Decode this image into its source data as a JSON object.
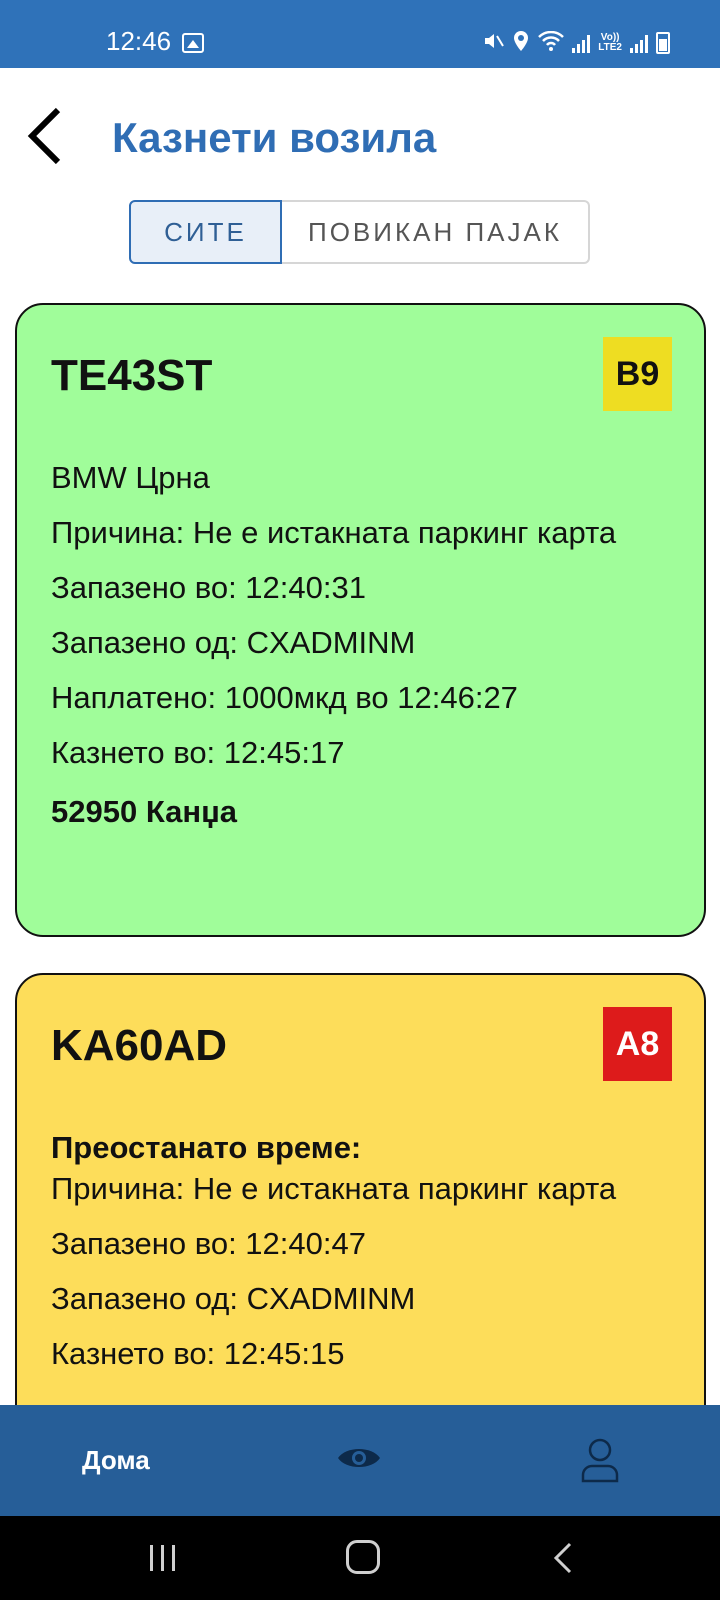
{
  "status_bar": {
    "time": "12:46",
    "icons": [
      "gallery-icon",
      "mute-icon",
      "location-icon",
      "wifi-icon",
      "signal-icon",
      "volte-icon",
      "signal-icon",
      "battery-icon"
    ],
    "volte_label_top": "Vo))",
    "volte_label_bottom": "LTE2"
  },
  "header": {
    "title": "Казнети возила",
    "back_icon": "back-arrow-icon"
  },
  "tabs": [
    {
      "label": "СИТЕ",
      "active": true
    },
    {
      "label": "ПОВИКАН ПАЈАК",
      "active": false
    }
  ],
  "cards": [
    {
      "plate": "TE43ST",
      "badge": "B9",
      "color": "#a0fd9a",
      "badge_color": "#eedd22",
      "lines": {
        "vehicle": "BMW Црна",
        "reason": "Причина: Не е истакната паркинг карта",
        "saved_at": "Запазено во: 12:40:31",
        "saved_by": "Запазено од: CXADMINM",
        "paid": "Наплатено: 1000мкд во 12:46:27",
        "fined_at": "Казнето во: 12:45:17",
        "office": "52950 Канџа"
      }
    },
    {
      "plate": "KA60AD",
      "badge": "A8",
      "color": "#fddd5a",
      "badge_color": "#dd1b1b",
      "lines": {
        "remaining": "Преостанато време:",
        "reason": "Причина: Не е истакната паркинг карта",
        "saved_at": "Запазено во: 12:40:47",
        "saved_by": "Запазено од: CXADMINM",
        "fined_at_partial": "Казнето во: 12:45:15"
      }
    }
  ],
  "bottom_nav": {
    "home_label": "Дома",
    "eye_icon": "eye-icon",
    "profile_icon": "user-icon"
  },
  "system_nav": {
    "icons": [
      "recent-apps-icon",
      "home-icon",
      "back-icon"
    ]
  }
}
